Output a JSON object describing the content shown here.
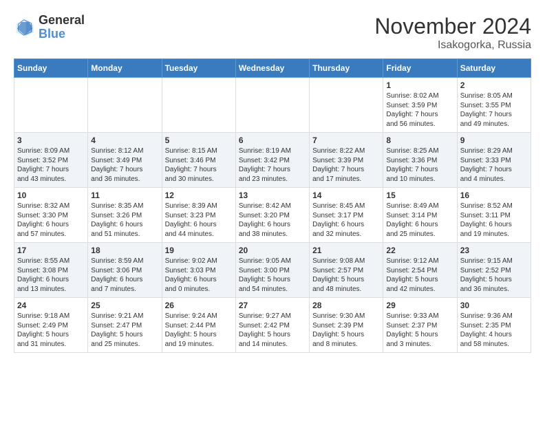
{
  "logo": {
    "line1": "General",
    "line2": "Blue"
  },
  "title": "November 2024",
  "location": "Isakogorka, Russia",
  "weekdays": [
    "Sunday",
    "Monday",
    "Tuesday",
    "Wednesday",
    "Thursday",
    "Friday",
    "Saturday"
  ],
  "weeks": [
    [
      {
        "day": "",
        "info": ""
      },
      {
        "day": "",
        "info": ""
      },
      {
        "day": "",
        "info": ""
      },
      {
        "day": "",
        "info": ""
      },
      {
        "day": "",
        "info": ""
      },
      {
        "day": "1",
        "info": "Sunrise: 8:02 AM\nSunset: 3:59 PM\nDaylight: 7 hours\nand 56 minutes."
      },
      {
        "day": "2",
        "info": "Sunrise: 8:05 AM\nSunset: 3:55 PM\nDaylight: 7 hours\nand 49 minutes."
      }
    ],
    [
      {
        "day": "3",
        "info": "Sunrise: 8:09 AM\nSunset: 3:52 PM\nDaylight: 7 hours\nand 43 minutes."
      },
      {
        "day": "4",
        "info": "Sunrise: 8:12 AM\nSunset: 3:49 PM\nDaylight: 7 hours\nand 36 minutes."
      },
      {
        "day": "5",
        "info": "Sunrise: 8:15 AM\nSunset: 3:46 PM\nDaylight: 7 hours\nand 30 minutes."
      },
      {
        "day": "6",
        "info": "Sunrise: 8:19 AM\nSunset: 3:42 PM\nDaylight: 7 hours\nand 23 minutes."
      },
      {
        "day": "7",
        "info": "Sunrise: 8:22 AM\nSunset: 3:39 PM\nDaylight: 7 hours\nand 17 minutes."
      },
      {
        "day": "8",
        "info": "Sunrise: 8:25 AM\nSunset: 3:36 PM\nDaylight: 7 hours\nand 10 minutes."
      },
      {
        "day": "9",
        "info": "Sunrise: 8:29 AM\nSunset: 3:33 PM\nDaylight: 7 hours\nand 4 minutes."
      }
    ],
    [
      {
        "day": "10",
        "info": "Sunrise: 8:32 AM\nSunset: 3:30 PM\nDaylight: 6 hours\nand 57 minutes."
      },
      {
        "day": "11",
        "info": "Sunrise: 8:35 AM\nSunset: 3:26 PM\nDaylight: 6 hours\nand 51 minutes."
      },
      {
        "day": "12",
        "info": "Sunrise: 8:39 AM\nSunset: 3:23 PM\nDaylight: 6 hours\nand 44 minutes."
      },
      {
        "day": "13",
        "info": "Sunrise: 8:42 AM\nSunset: 3:20 PM\nDaylight: 6 hours\nand 38 minutes."
      },
      {
        "day": "14",
        "info": "Sunrise: 8:45 AM\nSunset: 3:17 PM\nDaylight: 6 hours\nand 32 minutes."
      },
      {
        "day": "15",
        "info": "Sunrise: 8:49 AM\nSunset: 3:14 PM\nDaylight: 6 hours\nand 25 minutes."
      },
      {
        "day": "16",
        "info": "Sunrise: 8:52 AM\nSunset: 3:11 PM\nDaylight: 6 hours\nand 19 minutes."
      }
    ],
    [
      {
        "day": "17",
        "info": "Sunrise: 8:55 AM\nSunset: 3:08 PM\nDaylight: 6 hours\nand 13 minutes."
      },
      {
        "day": "18",
        "info": "Sunrise: 8:59 AM\nSunset: 3:06 PM\nDaylight: 6 hours\nand 7 minutes."
      },
      {
        "day": "19",
        "info": "Sunrise: 9:02 AM\nSunset: 3:03 PM\nDaylight: 6 hours\nand 0 minutes."
      },
      {
        "day": "20",
        "info": "Sunrise: 9:05 AM\nSunset: 3:00 PM\nDaylight: 5 hours\nand 54 minutes."
      },
      {
        "day": "21",
        "info": "Sunrise: 9:08 AM\nSunset: 2:57 PM\nDaylight: 5 hours\nand 48 minutes."
      },
      {
        "day": "22",
        "info": "Sunrise: 9:12 AM\nSunset: 2:54 PM\nDaylight: 5 hours\nand 42 minutes."
      },
      {
        "day": "23",
        "info": "Sunrise: 9:15 AM\nSunset: 2:52 PM\nDaylight: 5 hours\nand 36 minutes."
      }
    ],
    [
      {
        "day": "24",
        "info": "Sunrise: 9:18 AM\nSunset: 2:49 PM\nDaylight: 5 hours\nand 31 minutes."
      },
      {
        "day": "25",
        "info": "Sunrise: 9:21 AM\nSunset: 2:47 PM\nDaylight: 5 hours\nand 25 minutes."
      },
      {
        "day": "26",
        "info": "Sunrise: 9:24 AM\nSunset: 2:44 PM\nDaylight: 5 hours\nand 19 minutes."
      },
      {
        "day": "27",
        "info": "Sunrise: 9:27 AM\nSunset: 2:42 PM\nDaylight: 5 hours\nand 14 minutes."
      },
      {
        "day": "28",
        "info": "Sunrise: 9:30 AM\nSunset: 2:39 PM\nDaylight: 5 hours\nand 8 minutes."
      },
      {
        "day": "29",
        "info": "Sunrise: 9:33 AM\nSunset: 2:37 PM\nDaylight: 5 hours\nand 3 minutes."
      },
      {
        "day": "30",
        "info": "Sunrise: 9:36 AM\nSunset: 2:35 PM\nDaylight: 4 hours\nand 58 minutes."
      }
    ]
  ]
}
